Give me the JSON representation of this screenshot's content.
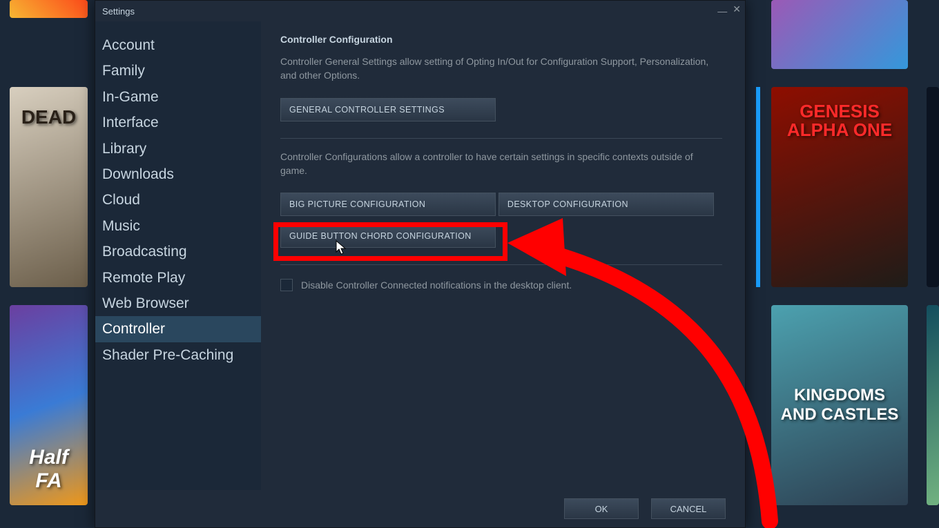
{
  "window": {
    "title": "Settings"
  },
  "sidebar": {
    "items": [
      {
        "label": "Account"
      },
      {
        "label": "Family"
      },
      {
        "label": "In-Game"
      },
      {
        "label": "Interface"
      },
      {
        "label": "Library"
      },
      {
        "label": "Downloads"
      },
      {
        "label": "Cloud"
      },
      {
        "label": "Music"
      },
      {
        "label": "Broadcasting"
      },
      {
        "label": "Remote Play"
      },
      {
        "label": "Web Browser"
      },
      {
        "label": "Controller"
      },
      {
        "label": "Shader Pre-Caching"
      }
    ],
    "selected_index": 11
  },
  "content": {
    "heading": "Controller Configuration",
    "desc1": "Controller General Settings allow setting of Opting In/Out for Configuration Support, Personalization, and other Options.",
    "btn_general": "GENERAL CONTROLLER SETTINGS",
    "desc2": "Controller Configurations allow a controller to have certain settings in specific contexts outside of game.",
    "btn_bigpicture": "BIG PICTURE CONFIGURATION",
    "btn_desktop": "DESKTOP CONFIGURATION",
    "btn_guide": "GUIDE BUTTON CHORD CONFIGURATION",
    "checkbox_label": "Disable Controller Connected notifications in the desktop client."
  },
  "footer": {
    "ok": "OK",
    "cancel": "CANCEL"
  },
  "bg_tiles": {
    "t1": "",
    "t2": "DEAD",
    "t3": "Half FA",
    "t4": "",
    "t5": "GENESIS ALPHA ONE",
    "t6": "KINGDOMS AND CASTLES",
    "t7": ""
  },
  "colors": {
    "annotation": "#ff0000"
  }
}
